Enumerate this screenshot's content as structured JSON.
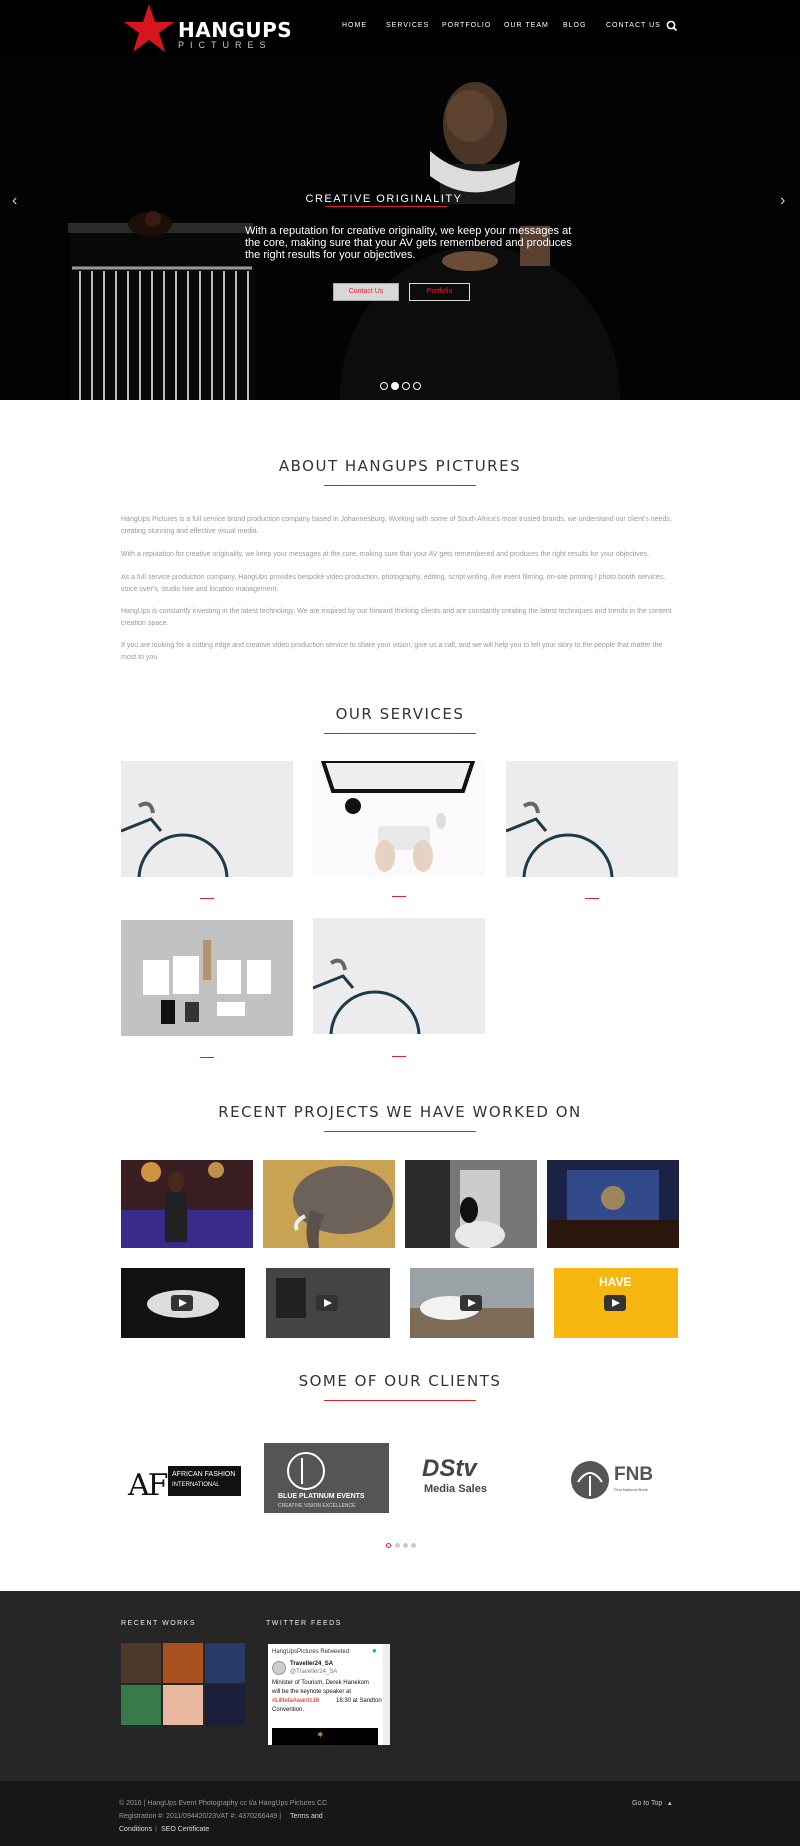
{
  "nav": {
    "logo": "HANGUPS",
    "logo_sub": "PICTURES",
    "items": [
      "HOME",
      "SERVICES",
      "PORTFOLIO",
      "OUR TEAM",
      "BLOG",
      "CONTACT US"
    ]
  },
  "hero": {
    "title": "CREATIVE ORIGINALITY",
    "description": "With a reputation for creative originality, we keep your messages at the core, making sure that your AV gets remembered and produces the right results for your objectives.",
    "btn_contact": "Contact Us",
    "btn_portfolio": "Portfolio",
    "slides": 4,
    "active_slide": 2
  },
  "about": {
    "title": "ABOUT HANGUPS PICTURES",
    "paragraphs": [
      "HangUps Pictures is a full service brand production company based in Johannesburg. Working with some of South Africa's most trusted brands, we understand our client's needs, creating stunning and effective visual media.",
      "With a reputation for creative originality, we keep your messages at the core, making sure that your AV gets remembered and produces the right results for your objectives.",
      "As a full service production company, HangUps provides bespoke video production, photography, editing, script writing, live event filming, on-site printing / photo booth services, voice over's, studio hire and location management.",
      "HangUps is constantly investing in the latest technology. We are inspired by our forward thinking clients and are constantly creating the latest techniques and trends in the content creation space.",
      "If you are looking for a cutting edge and creative video production service to share your vision, give us a call, and we will help you to tell your story to the people that matter the most to you."
    ]
  },
  "services": {
    "title": "OUR SERVICES"
  },
  "projects": {
    "title": "RECENT PROJECTS WE HAVE WORKED ON"
  },
  "clients": {
    "title": "SOME OF OUR CLIENTS",
    "aft_big": "AFI",
    "aft_name": "AFRICAN FASHION",
    "aft_sub": "INTERNATIONAL",
    "blue_name": "BLUE PLATINUM EVENTS",
    "blue_sub": "CREATIVE VISION EXCELLENCE",
    "dstv": "DStv",
    "dstv_sub": "Media Sales",
    "fnb": "FNB",
    "fnb_sub": "First National Bank"
  },
  "footer": {
    "recent_works": "RECENT WORKS",
    "twitter_feeds": "TWITTER FEEDS",
    "tweet_retweeted": "HangUpsPictures Retweeted",
    "tweet_user": "Traveller24_SA",
    "tweet_handle": "@Traveller24_SA",
    "tweet_text_1": "Minister of Tourism, Derek Hanekom",
    "tweet_text_2": "will be the keynote speaker at",
    "tweet_hashtag": "#LiliteIaAwards16",
    "tweet_text_3": "16:30 at Sandton",
    "tweet_text_4": "Convention."
  },
  "bottom": {
    "line1": "© 2016 | HangUps Event Photography cc t/a HangUps Pictures CC",
    "line2": "Registration #: 2011/094420/23VAT #: 4370266449 |",
    "terms": "Terms and",
    "line3a": "Conditions",
    "seo": "SEO Certificate",
    "go_top": "Go to Top"
  }
}
